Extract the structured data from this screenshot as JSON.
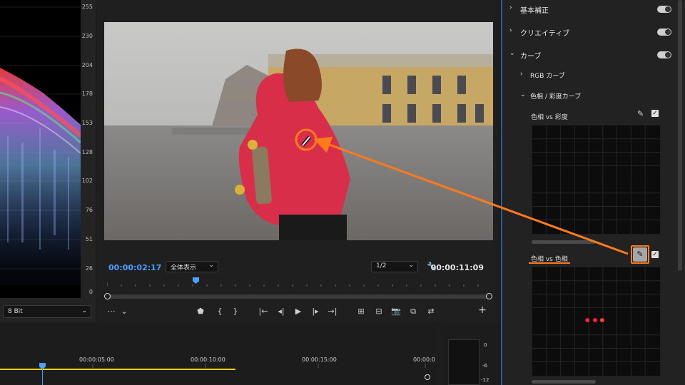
{
  "scopes": {
    "ticks": [
      "255",
      "230",
      "204",
      "178",
      "153",
      "128",
      "102",
      "76",
      "51",
      "26",
      "0"
    ],
    "bit_depth": "8 Bit"
  },
  "monitor": {
    "current_timecode": "00:00:02:17",
    "duration_timecode": "00:00:11:09",
    "zoom": "全体表示",
    "resolution": "1/2"
  },
  "lumetri": {
    "sections": [
      {
        "label": "基本補正",
        "expanded": false
      },
      {
        "label": "クリエイティブ",
        "expanded": false
      },
      {
        "label": "カーブ",
        "expanded": true
      }
    ],
    "rgb_curve": "RGB カーブ",
    "hue_sat_curves": "色相 / 彩度カーブ",
    "hue_vs_sat": "色相 vs 彩度",
    "hue_vs_hue": "色相 vs 色相"
  },
  "timeline": {
    "labels": [
      "00:00:05:00",
      "00:00:10:00",
      "00:00:15:00",
      "00:00:0"
    ]
  },
  "meter": {
    "ticks": [
      "0",
      "-6",
      "-12"
    ]
  },
  "colors": {
    "accent": "#4aa0ff",
    "annotation": "#ff7a1a",
    "in_out_bar": "#e8d21a"
  }
}
